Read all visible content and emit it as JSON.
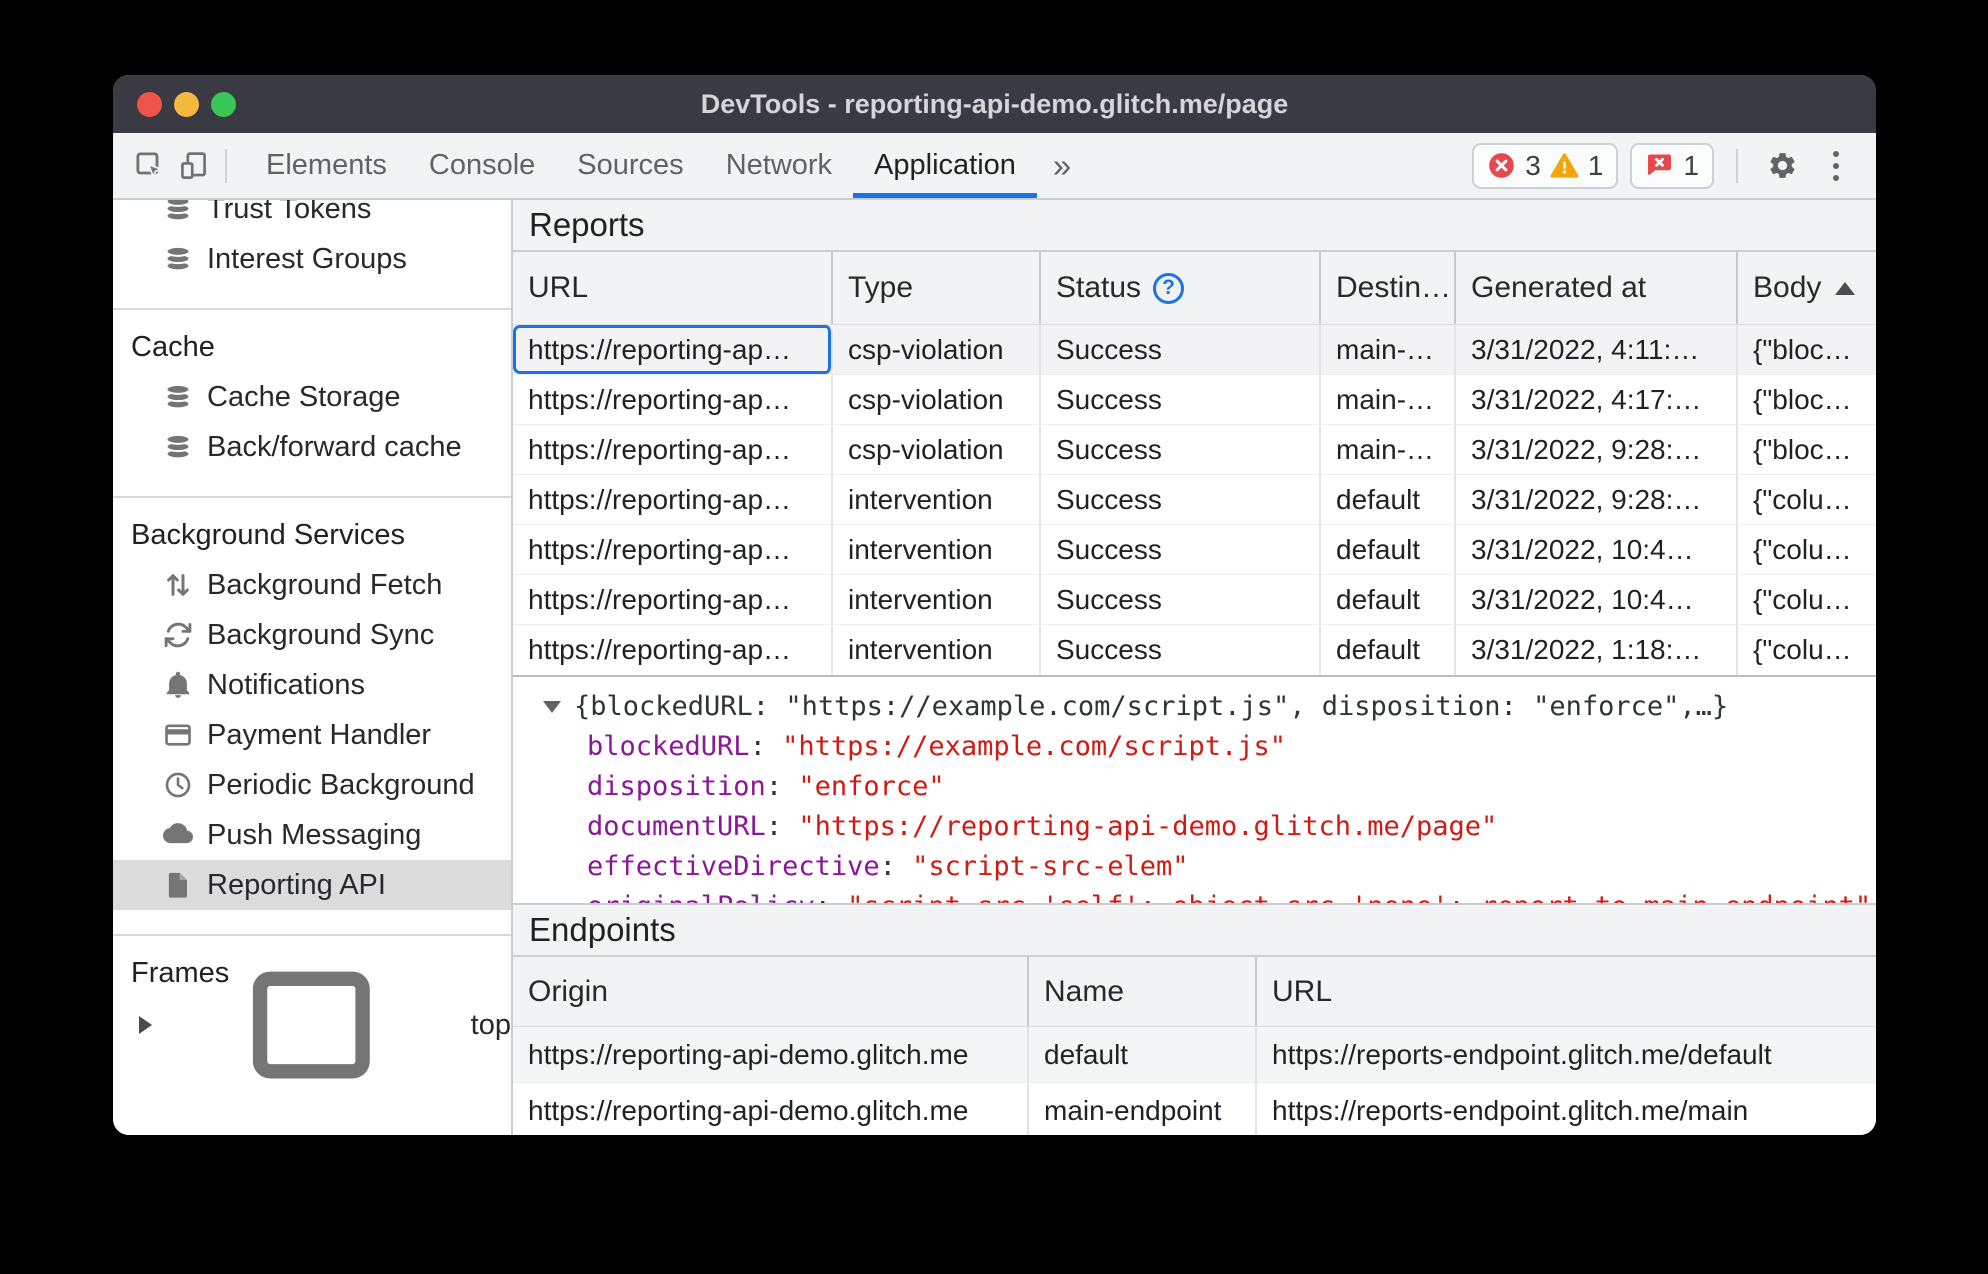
{
  "window": {
    "title": "DevTools - reporting-api-demo.glitch.me/page"
  },
  "toolbar": {
    "tabs": [
      {
        "label": "Elements"
      },
      {
        "label": "Console"
      },
      {
        "label": "Sources"
      },
      {
        "label": "Network"
      },
      {
        "label": "Application"
      }
    ],
    "active_tab": "Application",
    "more_tabs_glyph": "»",
    "error_count": "3",
    "warning_count": "1",
    "issue_count": "1"
  },
  "sidebar": {
    "items_top": [
      {
        "label": "Trust Tokens"
      },
      {
        "label": "Interest Groups"
      }
    ],
    "cache": {
      "title": "Cache",
      "items": [
        {
          "label": "Cache Storage"
        },
        {
          "label": "Back/forward cache"
        }
      ]
    },
    "background_services": {
      "title": "Background Services",
      "items": [
        {
          "label": "Background Fetch"
        },
        {
          "label": "Background Sync"
        },
        {
          "label": "Notifications"
        },
        {
          "label": "Payment Handler"
        },
        {
          "label": "Periodic Background"
        },
        {
          "label": "Push Messaging"
        },
        {
          "label": "Reporting API"
        }
      ]
    },
    "frames": {
      "title": "Frames",
      "items": [
        {
          "label": "top"
        }
      ]
    },
    "selected_item": "Reporting API"
  },
  "reports": {
    "title": "Reports",
    "columns": {
      "url": "URL",
      "type": "Type",
      "status": "Status",
      "destination": "Destin…",
      "generated": "Generated at",
      "body": "Body"
    },
    "help_glyph": "?",
    "rows": [
      {
        "url": "https://reporting-ap…",
        "type": "csp-violation",
        "status": "Success",
        "destination": "main-…",
        "generated": "3/31/2022, 4:11:…",
        "body": "{\"bloc…"
      },
      {
        "url": "https://reporting-ap…",
        "type": "csp-violation",
        "status": "Success",
        "destination": "main-…",
        "generated": "3/31/2022, 4:17:…",
        "body": "{\"bloc…"
      },
      {
        "url": "https://reporting-ap…",
        "type": "csp-violation",
        "status": "Success",
        "destination": "main-…",
        "generated": "3/31/2022, 9:28:…",
        "body": "{\"bloc…"
      },
      {
        "url": "https://reporting-ap…",
        "type": "intervention",
        "status": "Success",
        "destination": "default",
        "generated": "3/31/2022, 9:28:…",
        "body": "{\"colu…"
      },
      {
        "url": "https://reporting-ap…",
        "type": "intervention",
        "status": "Success",
        "destination": "default",
        "generated": "3/31/2022, 10:4…",
        "body": "{\"colu…"
      },
      {
        "url": "https://reporting-ap…",
        "type": "intervention",
        "status": "Success",
        "destination": "default",
        "generated": "3/31/2022, 10:4…",
        "body": "{\"colu…"
      },
      {
        "url": "https://reporting-ap…",
        "type": "intervention",
        "status": "Success",
        "destination": "default",
        "generated": "3/31/2022, 1:18:…",
        "body": "{\"colu…"
      }
    ]
  },
  "preview": {
    "summary": "{blockedURL: \"https://example.com/script.js\", disposition: \"enforce\",…}",
    "fields": [
      {
        "key": "blockedURL",
        "value": "\"https://example.com/script.js\""
      },
      {
        "key": "disposition",
        "value": "\"enforce\""
      },
      {
        "key": "documentURL",
        "value": "\"https://reporting-api-demo.glitch.me/page\""
      },
      {
        "key": "effectiveDirective",
        "value": "\"script-src-elem\""
      },
      {
        "key": "originalPolicy",
        "value": "\"script-src 'self'; object-src 'none'; report-to main-endpoint\""
      }
    ]
  },
  "endpoints": {
    "title": "Endpoints",
    "columns": {
      "origin": "Origin",
      "name": "Name",
      "url": "URL"
    },
    "rows": [
      {
        "origin": "https://reporting-api-demo.glitch.me",
        "name": "default",
        "url": "https://reports-endpoint.glitch.me/default"
      },
      {
        "origin": "https://reporting-api-demo.glitch.me",
        "name": "main-endpoint",
        "url": "https://reports-endpoint.glitch.me/main"
      }
    ]
  },
  "colors": {
    "accent": "#1a73e8",
    "titlebar": "#3a3a42",
    "toolbar_bg": "#f1f3f4",
    "error": "#e5494d",
    "warning": "#f2a60d",
    "json_key": "#8a1699",
    "json_string": "#cf1b13",
    "traffic_red": "#ee544a",
    "traffic_yellow": "#f6b73e",
    "traffic_green": "#39c655"
  }
}
